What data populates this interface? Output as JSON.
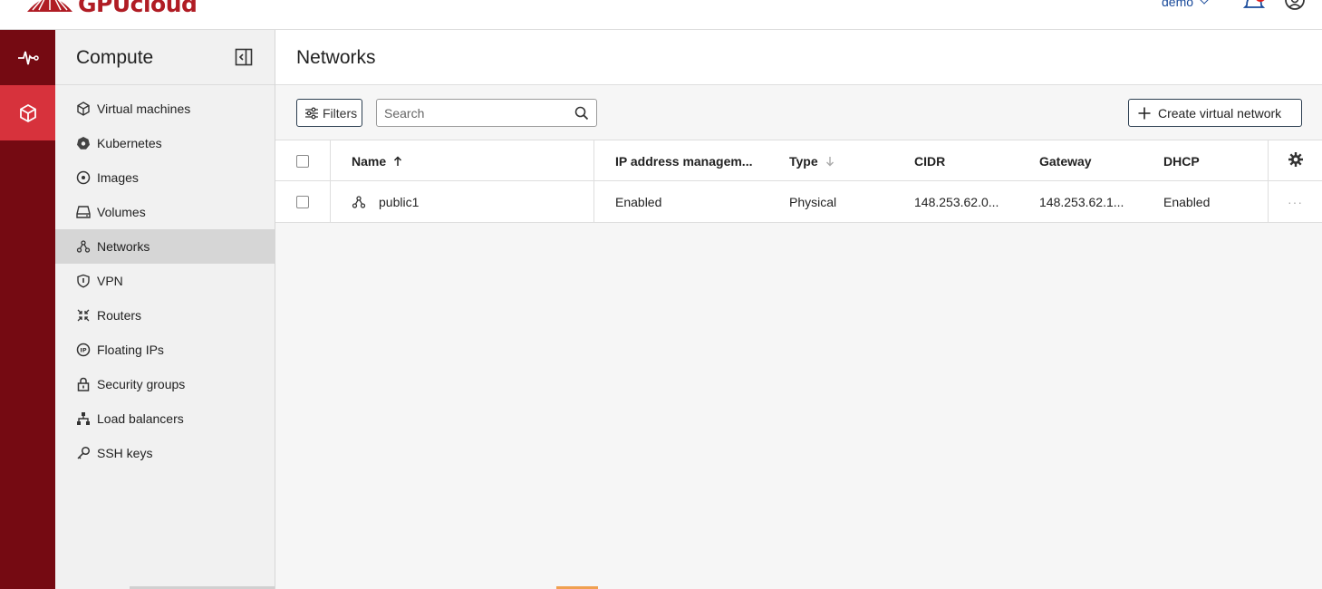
{
  "brand": {
    "name": "GPUcloud",
    "color": "#b01c24"
  },
  "topbar": {
    "user": "demo",
    "notification_icon": "bell-icon",
    "account_icon": "user-circle-icon"
  },
  "rail": [
    {
      "name": "monitoring",
      "icon": "pulse-icon",
      "active": false
    },
    {
      "name": "compute",
      "icon": "cube-icon",
      "active": true
    }
  ],
  "sidebar": {
    "title": "Compute",
    "items": [
      {
        "label": "Virtual machines",
        "icon": "cube-icon",
        "active": false
      },
      {
        "label": "Kubernetes",
        "icon": "kubernetes-icon",
        "active": false
      },
      {
        "label": "Images",
        "icon": "disc-icon",
        "active": false
      },
      {
        "label": "Volumes",
        "icon": "drive-icon",
        "active": false
      },
      {
        "label": "Networks",
        "icon": "network-icon",
        "active": true
      },
      {
        "label": "VPN",
        "icon": "shield-icon",
        "active": false
      },
      {
        "label": "Routers",
        "icon": "router-icon",
        "active": false
      },
      {
        "label": "Floating IPs",
        "icon": "ip-icon",
        "active": false
      },
      {
        "label": "Security groups",
        "icon": "lock-icon",
        "active": false
      },
      {
        "label": "Load balancers",
        "icon": "hierarchy-icon",
        "active": false
      },
      {
        "label": "SSH keys",
        "icon": "key-icon",
        "active": false
      }
    ]
  },
  "main": {
    "title": "Networks",
    "toolbar": {
      "filters_label": "Filters",
      "search_placeholder": "Search",
      "create_label": "Create virtual network"
    },
    "table": {
      "columns": {
        "name": "Name",
        "ipam": "IP address managem...",
        "type": "Type",
        "cidr": "CIDR",
        "gateway": "Gateway",
        "dhcp": "DHCP"
      },
      "rows": [
        {
          "name": "public1",
          "ipam": "Enabled",
          "type": "Physical",
          "cidr": "148.253.62.0...",
          "gateway": "148.253.62.1...",
          "dhcp": "Enabled",
          "actions": "···"
        }
      ]
    }
  }
}
